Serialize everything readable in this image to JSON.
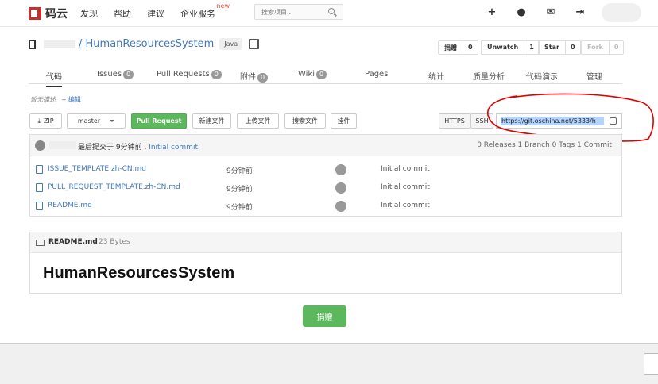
{
  "nav": {
    "logo_text": "码云",
    "links": [
      "发现",
      "帮助",
      "建议",
      "企业服务"
    ],
    "new_badge": "new",
    "search_placeholder": "搜索项目..."
  },
  "project": {
    "name": "HumanResourcesSystem",
    "separator": "/",
    "language": "Java",
    "donate_label": "捐赠",
    "donate_count": "0",
    "watch_label": "Unwatch",
    "watch_count": "1",
    "star_label": "Star",
    "star_count": "0",
    "fork_label": "Fork",
    "fork_count": "0"
  },
  "tabs": [
    {
      "label": "代码",
      "badge": null
    },
    {
      "label": "Issues",
      "badge": "0"
    },
    {
      "label": "Pull Requests",
      "badge": "0"
    },
    {
      "label": "附件",
      "badge": "0"
    },
    {
      "label": "Wiki",
      "badge": "0"
    },
    {
      "label": "Pages",
      "badge": null
    },
    {
      "label": "统计",
      "badge": null
    },
    {
      "label": "质量分析",
      "badge": null
    },
    {
      "label": "代码演示",
      "badge": null
    },
    {
      "label": "管理",
      "badge": null
    }
  ],
  "description": {
    "text": "暂无描述",
    "edit_prefix": "--",
    "edit_link": "编辑"
  },
  "toolbar": {
    "zip_label": "ZIP",
    "branch_label": "master",
    "pull_request_label": "Pull Request",
    "new_file_label": "新建文件",
    "upload_label": "上传文件",
    "search_file_label": "搜索文件",
    "widget_label": "挂件",
    "https_label": "HTTPS",
    "ssh_label": "SSH",
    "clone_url": "https://git.oschina.net/5333/h"
  },
  "commit": {
    "text": "最后提交于 9分钟前 .",
    "message": "Initial commit",
    "stats": "0 Releases  1 Branch  0 Tags  1 Commit"
  },
  "files": [
    {
      "name": "ISSUE_TEMPLATE.zh-CN.md",
      "time": "9分钟前",
      "message": "Initial commit"
    },
    {
      "name": "PULL_REQUEST_TEMPLATE.zh-CN.md",
      "time": "9分钟前",
      "message": "Initial commit"
    },
    {
      "name": "README.md",
      "time": "9分钟前",
      "message": "Initial commit"
    }
  ],
  "readme": {
    "file": "README.md",
    "size": "23 Bytes",
    "heading": "HumanResourcesSystem"
  },
  "footer": {
    "donate_button": "捐赠"
  },
  "colors": {
    "brand_red": "#c72e2e",
    "link_blue": "#4078c0",
    "green": "#5cb85c",
    "annotation_red": "#e00000"
  }
}
